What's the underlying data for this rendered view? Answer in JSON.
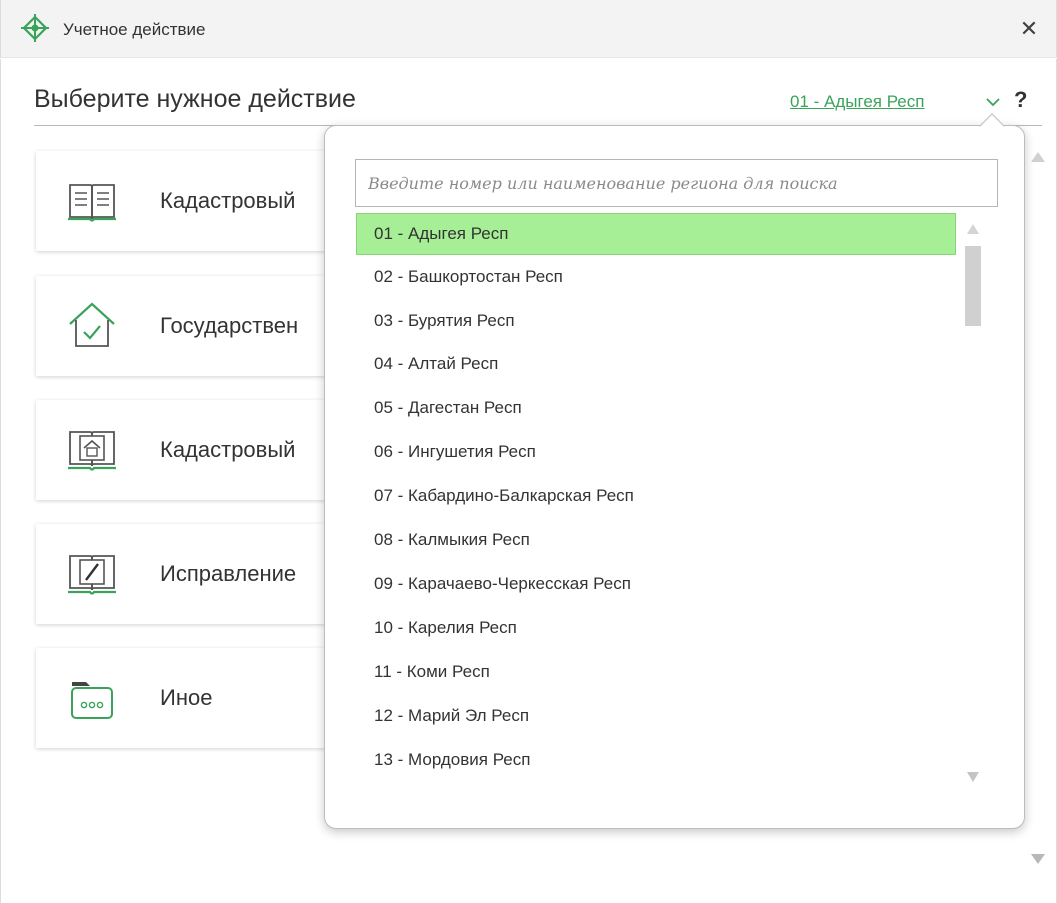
{
  "window": {
    "title": "Учетное действие",
    "app_icon": "crosshair-diamond-icon",
    "close_label": "✕",
    "accent_color": "#3aa35a"
  },
  "header": {
    "heading": "Выберите нужное действие",
    "region_link": "01 - Адыгея Респ",
    "chevron_icon": "chevron-down-icon",
    "help_label": "?"
  },
  "actions": [
    {
      "label": "Кадастровый",
      "icon": "book-icon"
    },
    {
      "label": "Государствен",
      "icon": "house-check-icon"
    },
    {
      "label": "Кадастровый",
      "icon": "book-house-icon"
    },
    {
      "label": "Исправление",
      "icon": "book-pencil-icon"
    },
    {
      "label": "Иное",
      "icon": "folder-dots-icon"
    }
  ],
  "region_dropdown": {
    "search_placeholder": "Введите номер или наименование региона для поиска",
    "search_value": "",
    "selected_index": 0,
    "selected_color": "#a6ef96",
    "items": [
      "01 - Адыгея Респ",
      "02 - Башкортостан Респ",
      "03 - Бурятия Респ",
      "04 - Алтай Респ",
      "05 - Дагестан Респ",
      "06 - Ингушетия Респ",
      "07 - Кабардино-Балкарская Респ",
      "08 - Калмыкия Респ",
      "09 - Карачаево-Черкесская Респ",
      "10 - Карелия Респ",
      "11 - Коми Респ",
      "12 - Марий Эл Респ",
      "13 - Мордовия Респ"
    ]
  }
}
